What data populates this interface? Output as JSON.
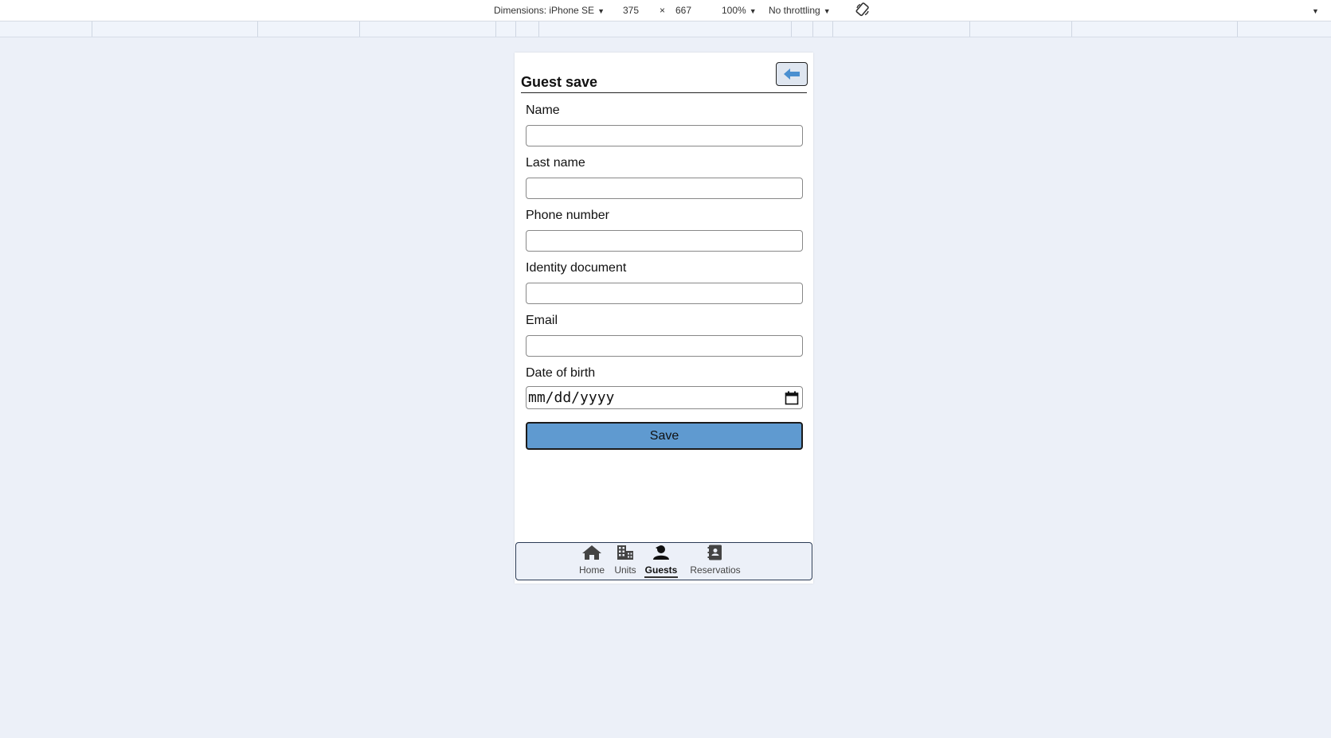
{
  "devtools": {
    "dimensions_label": "Dimensions: iPhone SE",
    "width": "375",
    "times": "×",
    "height": "667",
    "zoom": "100%",
    "throttling": "No throttling",
    "rotate_icon": "rotate-device-icon",
    "more_icon": "chevron-down-icon"
  },
  "page": {
    "title": "Guest save",
    "back_icon": "arrow-left-icon"
  },
  "form": {
    "name_label": "Name",
    "name_value": "",
    "last_name_label": "Last name",
    "last_name_value": "",
    "phone_label": "Phone number",
    "phone_value": "",
    "identity_label": "Identity document",
    "identity_value": "",
    "email_label": "Email",
    "email_value": "",
    "dob_label": "Date of birth",
    "dob_placeholder": "mm/dd/yyyy",
    "save_label": "Save"
  },
  "nav": {
    "items": [
      {
        "label": "Home",
        "icon": "home-icon",
        "active": false
      },
      {
        "label": "Units",
        "icon": "building-icon",
        "active": false
      },
      {
        "label": "Guests",
        "icon": "user-icon",
        "active": true
      },
      {
        "label": "Reservatios",
        "icon": "contact-book-icon",
        "active": false
      }
    ]
  },
  "colors": {
    "background": "#ecf0f8",
    "save_button": "#5f9ad0",
    "back_arrow": "#4a8fd0"
  }
}
